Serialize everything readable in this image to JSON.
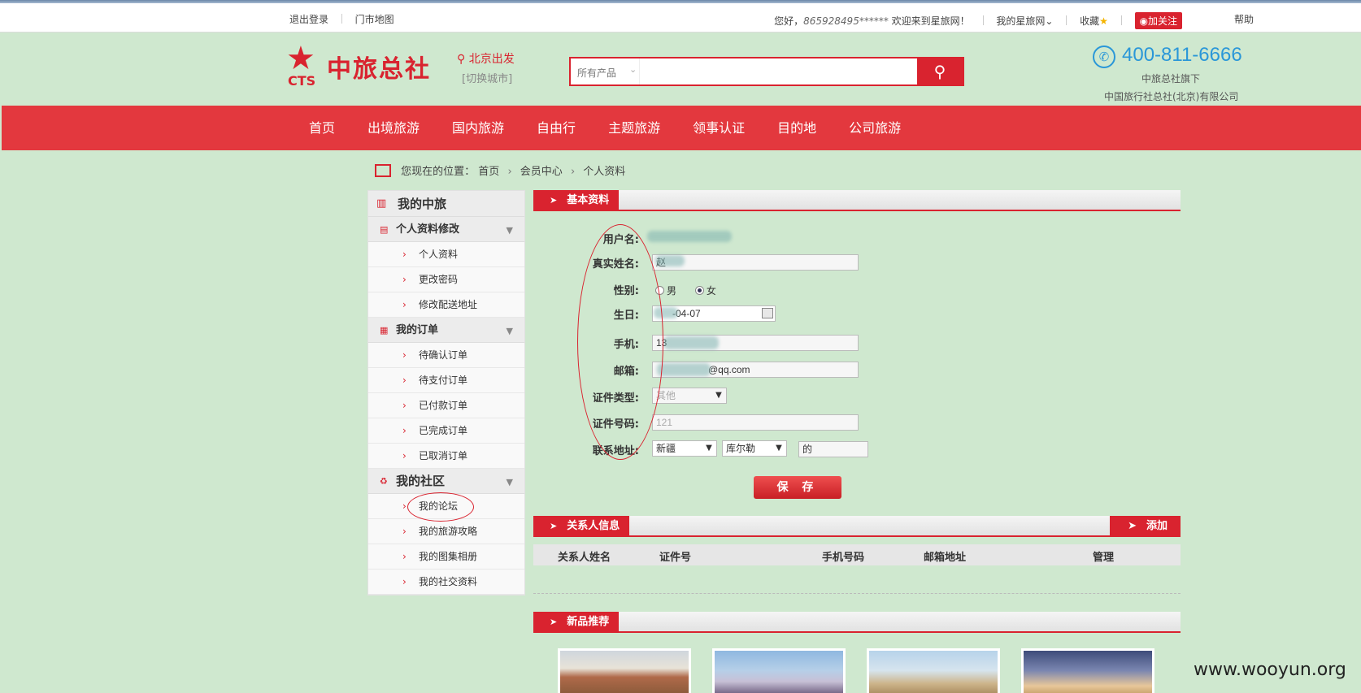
{
  "topbar": {
    "logout": "退出登录",
    "store_map": "门市地图",
    "greeting_prefix": "您好，",
    "user_masked": "865928495******",
    "greeting_suffix": "欢迎来到星旅网！",
    "my_star": "我的星旅网",
    "favorite": "收藏",
    "weibo": "加关注",
    "help": "帮助"
  },
  "header": {
    "logo_cts": "CTS",
    "logo_name": "中旅总社",
    "city": "北京出发",
    "city_switch": "[切换城市]",
    "search_category": "所有产品",
    "search_value": "",
    "phone": "400-811-6666",
    "sub1": "中旅总社旗下",
    "sub2": "中国旅行社总社(北京)有限公司"
  },
  "nav": [
    "首页",
    "出境旅游",
    "国内旅游",
    "自由行",
    "主题旅游",
    "领事认证",
    "目的地",
    "公司旅游"
  ],
  "breadcrumb": {
    "label": "您现在的位置：",
    "items": [
      "首页",
      "会员中心",
      "个人资料"
    ]
  },
  "sidebar": {
    "title": "我的中旅",
    "groups": [
      {
        "title": "个人资料修改",
        "items": [
          "个人资料",
          "更改密码",
          "修改配送地址"
        ]
      },
      {
        "title": "我的订单",
        "items": [
          "待确认订单",
          "待支付订单",
          "已付款订单",
          "已完成订单",
          "已取消订单"
        ]
      },
      {
        "title": "我的社区",
        "items": [
          "我的论坛",
          "我的旅游攻略",
          "我的图集相册",
          "我的社交资料"
        ]
      }
    ]
  },
  "basic": {
    "title": "基本资料",
    "labels": {
      "username": "用户名:",
      "realname": "真实姓名:",
      "gender": "性别:",
      "birthday": "生日:",
      "mobile": "手机:",
      "email": "邮箱:",
      "id_type": "证件类型:",
      "id_number": "证件号码:",
      "address": "联系地址:"
    },
    "values": {
      "realname": "赵",
      "gender_male": "男",
      "gender_female": "女",
      "birthday": "-04-07",
      "mobile": "13",
      "email": "@qq.com",
      "id_type": "其他",
      "id_number": "121",
      "province": "新疆",
      "city": "库尔勒",
      "address_detail": "的"
    },
    "save": "保 存"
  },
  "contacts": {
    "title": "关系人信息",
    "add": "添加",
    "columns": [
      "关系人姓名",
      "证件号",
      "手机号码",
      "邮箱地址",
      "管理"
    ]
  },
  "new_products": {
    "title": "新品推荐"
  },
  "watermark": "www.wooyun.org",
  "colors": {
    "brand_red": "#d9232f",
    "nav_red": "#e3383e",
    "page_bg": "#cfe8cf",
    "phone_blue": "#2a97d8"
  }
}
